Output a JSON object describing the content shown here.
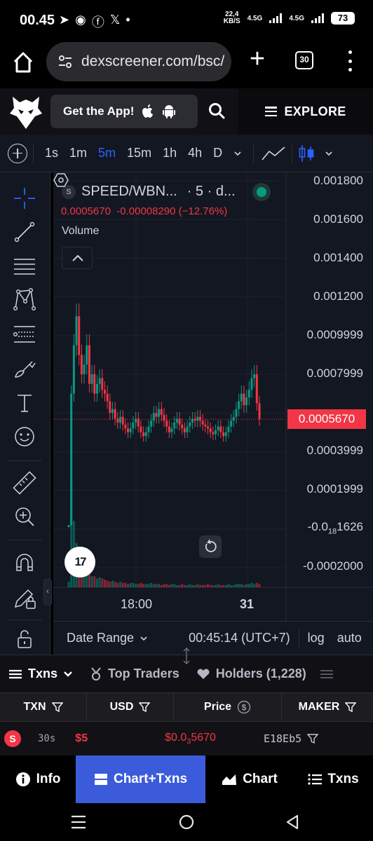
{
  "status_bar": {
    "time": "00.45",
    "speed_value": "22,4",
    "speed_unit": "KB/S",
    "network1": "4.5G",
    "network2": "4.5G",
    "battery": "73"
  },
  "browser": {
    "url": "dexscreener.com/bsc/",
    "tab_count": "30"
  },
  "site_header": {
    "get_app_label": "Get the App!",
    "explore_label": "EXPLORE"
  },
  "timeframes": [
    "1s",
    "1m",
    "5m",
    "15m",
    "1h",
    "4h",
    "D"
  ],
  "active_timeframe": "5m",
  "chart_legend": {
    "symbol_badge": "S",
    "symbol": "SPEED/WBN...",
    "interval": "· 5 · d...",
    "price": "0.0005670",
    "change": "-0.00008290",
    "change_pct": "(−12.76%)",
    "volume_label": "Volume"
  },
  "tv_logo": "17",
  "chart_data": {
    "type": "candlestick",
    "title": "SPEED/WBN...",
    "y_ticks": [
      "0.001800",
      "0.001600",
      "0.001400",
      "0.001200",
      "0.0009999",
      "0.0007999",
      "0.0003999",
      "0.0001999",
      "-0.0002000"
    ],
    "y_tick_special": {
      "prefix": "-0.0",
      "sub": "18",
      "suffix": "1626"
    },
    "ylim": [
      -0.0002,
      0.0018
    ],
    "x_ticks": [
      "18:00",
      "31"
    ],
    "last_price": "0.0005670",
    "last_price_color": "#f23645",
    "up_color": "#089981",
    "down_color": "#f23645",
    "close_series": [
      2e-05,
      0.0007,
      0.00095,
      0.0011,
      0.0009,
      0.0008,
      0.00085,
      0.00095,
      0.00075,
      0.0008,
      0.0007,
      0.00075,
      0.00078,
      0.00072,
      0.0007,
      0.00066,
      0.0006,
      0.00062,
      0.00057,
      0.00055,
      0.00058,
      0.00054,
      0.00052,
      0.0005,
      0.00052,
      0.00055,
      0.00057,
      0.00053,
      0.0005,
      0.00048,
      0.0005,
      0.00053,
      0.00056,
      0.0006,
      0.00058,
      0.00062,
      0.00059,
      0.00056,
      0.00053,
      0.0005,
      0.00052,
      0.00055,
      0.00057,
      0.00054,
      0.00052,
      0.0005,
      0.00053,
      0.00055,
      0.00057,
      0.00056,
      0.00058,
      0.00056,
      0.00054,
      0.00053,
      0.00052,
      0.0005,
      0.00049,
      0.00051,
      0.00053,
      0.0005,
      0.00048,
      0.0005,
      0.00053,
      0.00056,
      0.00058,
      0.00062,
      0.00066,
      0.0007,
      0.00064,
      0.00068,
      0.00072,
      0.00078,
      0.0008,
      0.00065,
      0.000567
    ],
    "volume_series": [
      5,
      95,
      60,
      40,
      30,
      20,
      18,
      15,
      12,
      10,
      10,
      8,
      9,
      8,
      7,
      6,
      5,
      6,
      5,
      4,
      5,
      4,
      4,
      3,
      4,
      4,
      3,
      3,
      4,
      3,
      3,
      3,
      4,
      3,
      3,
      3,
      2,
      3,
      3,
      2,
      3,
      3,
      2,
      2,
      3,
      2,
      2,
      3,
      2,
      2,
      3,
      2,
      2,
      2,
      3,
      2,
      2,
      2,
      3,
      2,
      2,
      2,
      3,
      2,
      2,
      3,
      3,
      3,
      2,
      3,
      3,
      4,
      3,
      4,
      3
    ]
  },
  "date_bar": {
    "date_range": "Date Range",
    "time": "00:45:14 (UTC+7)",
    "log": "log",
    "auto": "auto"
  },
  "tabs": {
    "txns": "Txns",
    "top_traders": "Top Traders",
    "holders": "Holders (1,228)"
  },
  "table": {
    "headers": [
      "TXN",
      "USD",
      "Price",
      "MAKER"
    ],
    "rows": [
      {
        "type": "S",
        "age": "30s",
        "usd": "$5",
        "price_prefix": "$0.0",
        "price_sub": "3",
        "price_suffix": "5670",
        "maker": "E18Eb5"
      }
    ]
  },
  "bottom_nav": {
    "info": "Info",
    "chart_txns": "Chart+Txns",
    "chart": "Chart",
    "txns": "Txns"
  }
}
